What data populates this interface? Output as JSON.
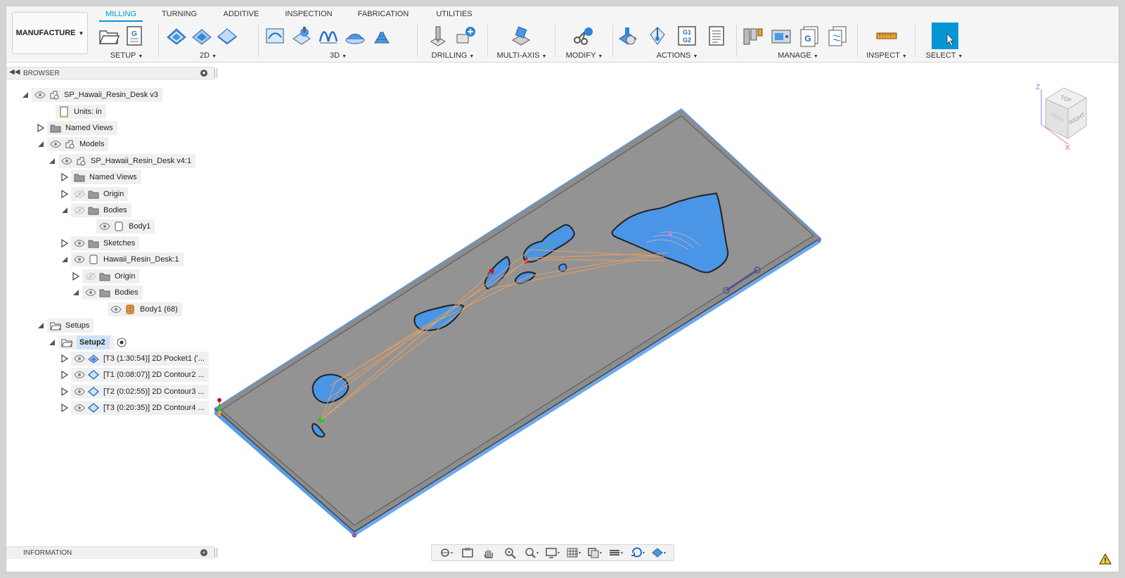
{
  "workspace": {
    "label": "MANUFACTURE"
  },
  "tabs": [
    {
      "label": "MILLING",
      "active": true
    },
    {
      "label": "TURNING"
    },
    {
      "label": "ADDITIVE"
    },
    {
      "label": "INSPECTION"
    },
    {
      "label": "FABRICATION"
    },
    {
      "label": "UTILITIES"
    }
  ],
  "toolbar_groups": {
    "setup": "SETUP",
    "g2d": "2D",
    "g3d": "3D",
    "drilling": "DRILLING",
    "multiaxis": "MULTI-AXIS",
    "modify": "MODIFY",
    "actions": "ACTIONS",
    "manage": "MANAGE",
    "inspect": "INSPECT",
    "select": "SELECT"
  },
  "icons": {
    "post_gcode": "G",
    "nc_gcode": "G1\nG2"
  },
  "browser": {
    "title": "BROWSER",
    "items": [
      {
        "label": "SP_Hawaii_Resin_Desk v3"
      },
      {
        "label": "Units: in"
      },
      {
        "label": "Named Views"
      },
      {
        "label": "Models"
      },
      {
        "label": "SP_Hawaii_Resin_Desk v4:1"
      },
      {
        "label": "Named Views"
      },
      {
        "label": "Origin"
      },
      {
        "label": "Bodies"
      },
      {
        "label": "Body1"
      },
      {
        "label": "Sketches"
      },
      {
        "label": "Hawaii_Resin_Desk:1"
      },
      {
        "label": "Origin"
      },
      {
        "label": "Bodies"
      },
      {
        "label": "Body1 (68)"
      },
      {
        "label": "Setups"
      },
      {
        "label": "Setup2"
      },
      {
        "label": "[T3 (1:30:54)] 2D Pocket1 ('..."
      },
      {
        "label": "[T1 (0:08:07)] 2D Contour2 ..."
      },
      {
        "label": "[T2 (0:02:55)] 2D Contour3 ..."
      },
      {
        "label": "[T3 (0:20:35)] 2D Contour4 ..."
      }
    ]
  },
  "information": {
    "title": "INFORMATION"
  },
  "view_cube": {
    "top": "TOP",
    "right": "RIGHT",
    "front": "FRONT",
    "axis_z": "Z",
    "axis_x": "X"
  },
  "colors": {
    "accent": "#0696d7",
    "stock": "#8c8c8c",
    "pocket": "#4a95e6",
    "toolpath": "#f2a05a",
    "edge": "#5a9be0"
  }
}
